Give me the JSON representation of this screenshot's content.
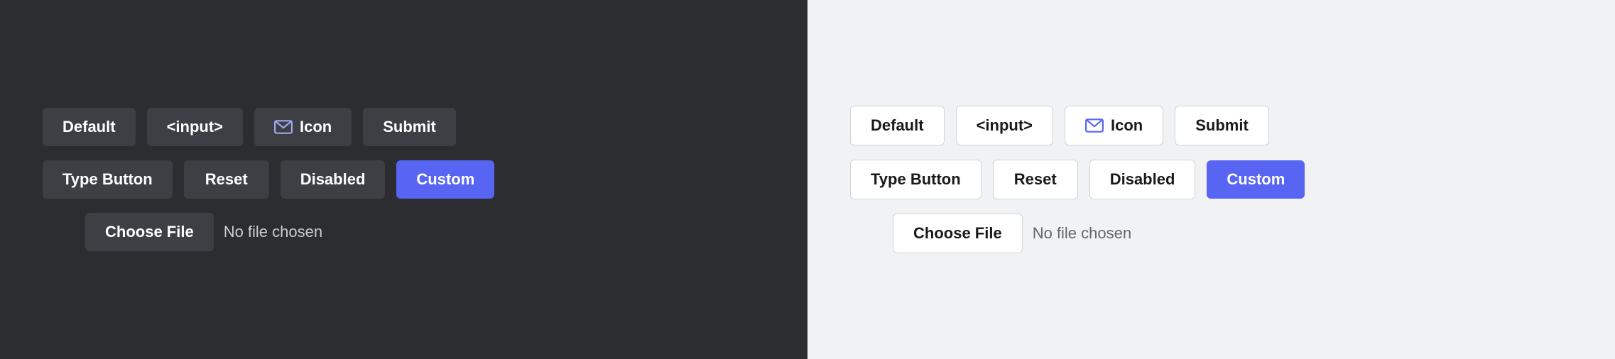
{
  "dark_panel": {
    "row1": {
      "btn_default": "Default",
      "btn_input": "<input>",
      "btn_icon_label": "Icon",
      "btn_submit": "Submit"
    },
    "row2": {
      "btn_type": "Type Button",
      "btn_reset": "Reset",
      "btn_disabled": "Disabled",
      "btn_custom": "Custom"
    },
    "file": {
      "btn_label": "Choose File",
      "file_text": "No file chosen"
    }
  },
  "light_panel": {
    "row1": {
      "btn_default": "Default",
      "btn_input": "<input>",
      "btn_icon_label": "Icon",
      "btn_submit": "Submit"
    },
    "row2": {
      "btn_type": "Type Button",
      "btn_reset": "Reset",
      "btn_disabled": "Disabled",
      "btn_custom": "Custom"
    },
    "file": {
      "btn_label": "Choose File",
      "file_text": "No file chosen"
    }
  }
}
